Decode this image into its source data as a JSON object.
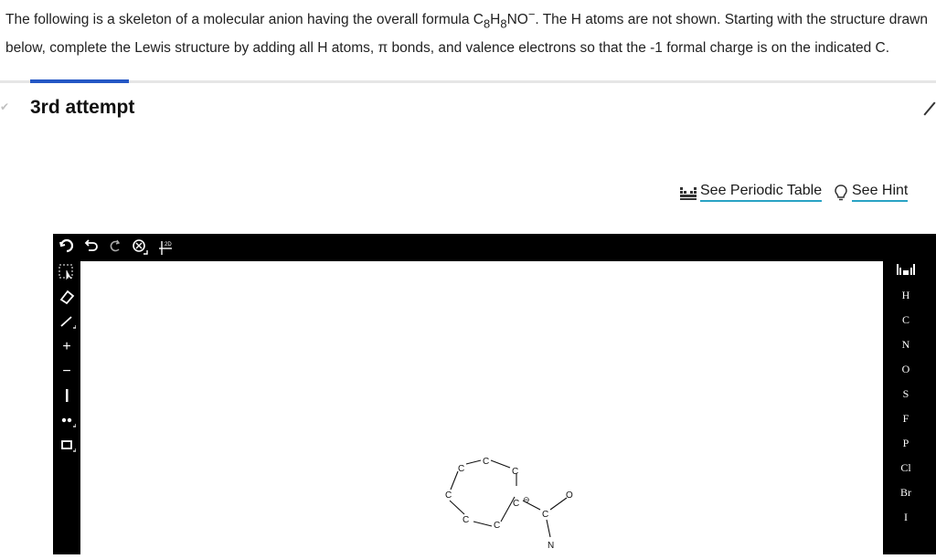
{
  "question": {
    "line1_pre": "The following is a skeleton of a molecular anion having the overall formula C",
    "sub8a": "8",
    "mid_h": "H",
    "sub8b": "8",
    "line1_post": "NO",
    "charge": "−",
    "line1_end": ". The H atoms are not shown. Starting with the structure drawn",
    "line2": "below, complete the Lewis structure by adding all H atoms, π bonds, and valence electrons so that the -1 formal charge is on the indicated C."
  },
  "attempt": {
    "label": "3rd attempt"
  },
  "links": {
    "periodic_table": "See Periodic Table",
    "hint": "See Hint"
  },
  "toolbar": {
    "icons": [
      "clear-icon",
      "undo-icon",
      "redo-icon",
      "zoom-icon",
      "2d-template-icon"
    ],
    "template_label": "2D"
  },
  "left_tools": [
    "select-icon",
    "eraser-icon",
    "bond-icon",
    "plus-charge-icon",
    "minus-charge-icon",
    "lone-pair-icon",
    "ring-icon"
  ],
  "elements": {
    "header_icon": "periodic-mini-icon",
    "list": [
      "H",
      "C",
      "N",
      "O",
      "S",
      "F",
      "P",
      "Cl",
      "Br",
      "I"
    ]
  },
  "molecule": {
    "atoms": [
      {
        "id": "c1",
        "label": "C"
      },
      {
        "id": "c2",
        "label": "C"
      },
      {
        "id": "c3",
        "label": "C"
      },
      {
        "id": "c4",
        "label": "C"
      },
      {
        "id": "c5",
        "label": "C"
      },
      {
        "id": "c6",
        "label": "C"
      },
      {
        "id": "c7",
        "label": "C"
      },
      {
        "id": "c8",
        "label": "C"
      },
      {
        "id": "o1",
        "label": "O"
      },
      {
        "id": "n1",
        "label": "N"
      }
    ],
    "charge_symbol": "⊖"
  }
}
